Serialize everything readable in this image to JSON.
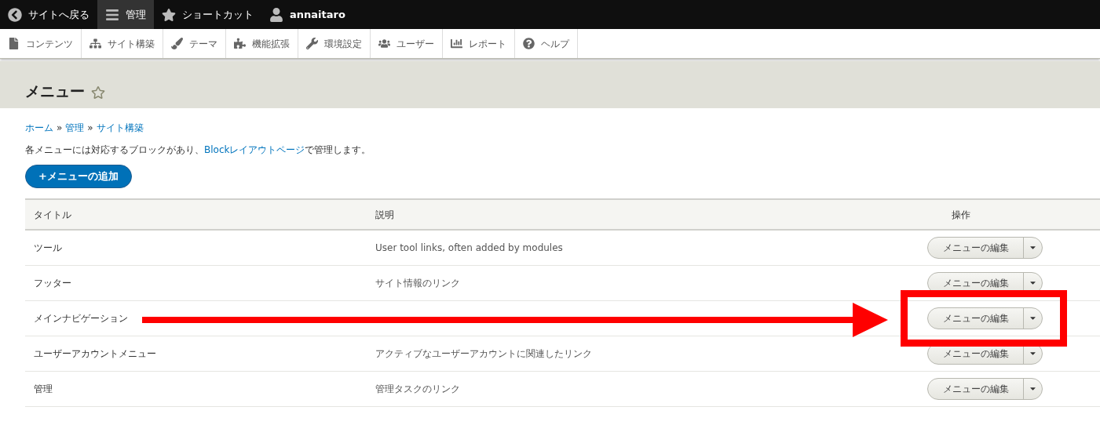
{
  "toolbar": {
    "items": [
      {
        "kind": "back",
        "label": "サイトへ戻る",
        "selected": false
      },
      {
        "kind": "menu",
        "label": "管理",
        "selected": true
      },
      {
        "kind": "star",
        "label": "ショートカット",
        "selected": false
      },
      {
        "kind": "user",
        "label": "annaitaro",
        "selected": false
      }
    ]
  },
  "tray": {
    "items": [
      {
        "kind": "file",
        "label": "コンテンツ"
      },
      {
        "kind": "sitemap",
        "label": "サイト構築"
      },
      {
        "kind": "brush",
        "label": "テーマ"
      },
      {
        "kind": "puzzle",
        "label": "機能拡張"
      },
      {
        "kind": "wrench",
        "label": "環境設定"
      },
      {
        "kind": "users",
        "label": "ユーザー"
      },
      {
        "kind": "chart",
        "label": "レポート"
      },
      {
        "kind": "help",
        "label": "ヘルプ"
      }
    ]
  },
  "page": {
    "title": "メニュー",
    "breadcrumb": [
      "ホーム",
      "管理",
      "サイト構築"
    ],
    "breadcrumb_separator": "»",
    "intro_before": "各メニューには対応するブロックがあり、",
    "intro_link": "Blockレイアウトページ",
    "intro_after": "で管理します。",
    "add_button": "+メニューの追加"
  },
  "table": {
    "columns": [
      "タイトル",
      "説明",
      "操作"
    ],
    "rows": [
      {
        "title": "ツール",
        "description": "User tool links, often added by modules",
        "operation": "メニューの編集"
      },
      {
        "title": "フッター",
        "description": "サイト情報のリンク",
        "operation": "メニューの編集"
      },
      {
        "title": "メインナビゲーション",
        "operation": "メニューの編集",
        "highlighted": true
      },
      {
        "title": "ユーザーアカウントメニュー",
        "description": "アクティブなユーザーアカウントに関連したリンク",
        "operation": "メニューの編集"
      },
      {
        "title": "管理",
        "description": "管理タスクのリンク",
        "operation": "メニューの編集"
      }
    ]
  }
}
